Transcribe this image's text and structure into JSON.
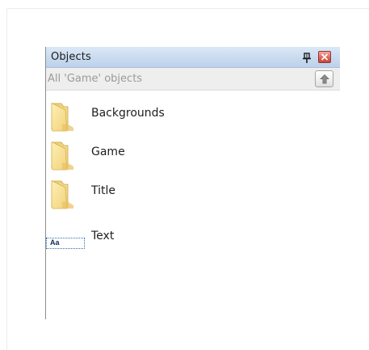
{
  "panel": {
    "title": "Objects",
    "path_label": "All 'Game' objects",
    "colors": {
      "titlebar": "#cbdcf0",
      "close": "#e36a5e"
    },
    "items": [
      {
        "label": "Backgrounds",
        "icon": "folder-icon"
      },
      {
        "label": "Game",
        "icon": "folder-icon"
      },
      {
        "label": "Title",
        "icon": "folder-icon"
      },
      {
        "label": "Text",
        "icon": "text-object-icon",
        "icon_text": "Aa"
      }
    ]
  }
}
